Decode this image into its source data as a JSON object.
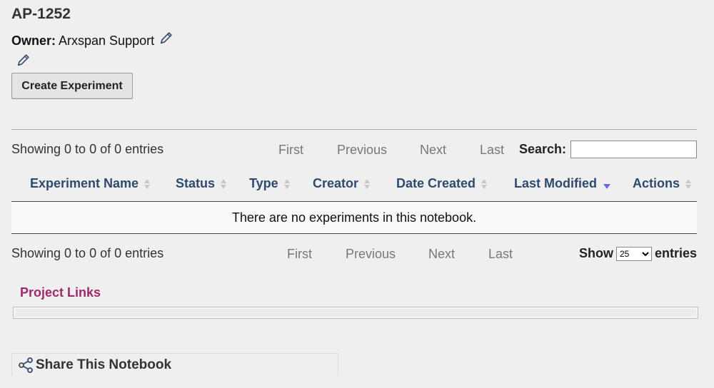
{
  "notebook": {
    "title": "AP-1252",
    "owner_label": "Owner:",
    "owner_name": "Arxspan Support"
  },
  "actions": {
    "create_experiment": "Create Experiment"
  },
  "table": {
    "info_top": "Showing 0 to 0 of 0 entries",
    "info_bottom": "Showing 0 to 0 of 0 entries",
    "pagination": {
      "first": "First",
      "previous": "Previous",
      "next": "Next",
      "last": "Last"
    },
    "search_label": "Search:",
    "search_value": "",
    "columns": [
      "Experiment Name",
      "Status",
      "Type",
      "Creator",
      "Date Created",
      "Last Modified",
      "Actions"
    ],
    "sorted_column": "Last Modified",
    "empty_message": "There are no experiments in this notebook.",
    "show_label": "Show",
    "page_size": "25",
    "entries_label": "entries"
  },
  "project_links": {
    "title": "Project Links"
  },
  "share": {
    "label": "Share This Notebook"
  },
  "icons": {
    "edit": "pencil-icon",
    "share": "share-icon",
    "sort": "sort-icon"
  },
  "colors": {
    "header_text": "#2f4a6e",
    "project_links": "#a0286a",
    "sort_active": "#6b6bd6"
  }
}
